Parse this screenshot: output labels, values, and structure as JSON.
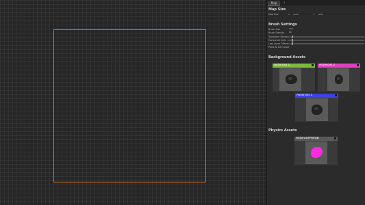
{
  "tabs": {
    "active": "Map",
    "second": "?"
  },
  "map_size": {
    "title": "Map Size",
    "label": "Map Size",
    "x_axis": "X",
    "x_value": "1000",
    "y_axis": "Y",
    "y_value": "1000"
  },
  "brush": {
    "title": "Brush Settings",
    "size_label": "Brush Size",
    "size_value": "200",
    "density_label": "Brush Density",
    "density_value": "80",
    "rows": [
      {
        "label": "Transform Random",
        "fill": 0.05
      },
      {
        "label": "Horizontal Cells",
        "fill": 0.05
      },
      {
        "label": "Last Layer Offset",
        "fill": 0.05
      }
    ],
    "toggle_label": "Paint At Gen Layer"
  },
  "background_assets": {
    "title": "Background Assets",
    "cards": [
      {
        "name": "Asteroid 1",
        "color": "#7dbb3b"
      },
      {
        "name": "Asteroid 2",
        "color": "#e040c0"
      },
      {
        "name": "Asteroid 1",
        "color": "#4040e8"
      }
    ]
  },
  "physics_assets": {
    "title": "Physics Assets",
    "cards": [
      {
        "name": "AsteroidPrefab",
        "color": "#5a5a5a"
      }
    ]
  }
}
